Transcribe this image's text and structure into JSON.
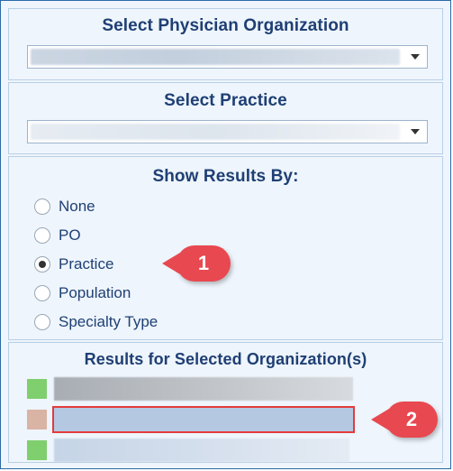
{
  "po_section": {
    "title": "Select Physician Organization"
  },
  "practice_section": {
    "title": "Select Practice"
  },
  "show_by": {
    "title": "Show Results By:",
    "options": [
      {
        "label": "None",
        "checked": false
      },
      {
        "label": "PO",
        "checked": false
      },
      {
        "label": "Practice",
        "checked": true
      },
      {
        "label": "Population",
        "checked": false
      },
      {
        "label": "Specialty Type",
        "checked": false
      }
    ]
  },
  "results": {
    "title": "Results for Selected Organization(s)",
    "rows": [
      {
        "swatch": "#7fcf6e",
        "selected": false
      },
      {
        "swatch": "#d9b3a3",
        "selected": true
      },
      {
        "swatch": "#7fcf6e",
        "selected": false
      }
    ]
  },
  "callouts": [
    {
      "label": "1"
    },
    {
      "label": "2"
    }
  ],
  "colors": {
    "accent": "#1f3f74",
    "border": "#2b6aa8",
    "callout": "#e84850",
    "selection_outline": "#e23b3b"
  }
}
